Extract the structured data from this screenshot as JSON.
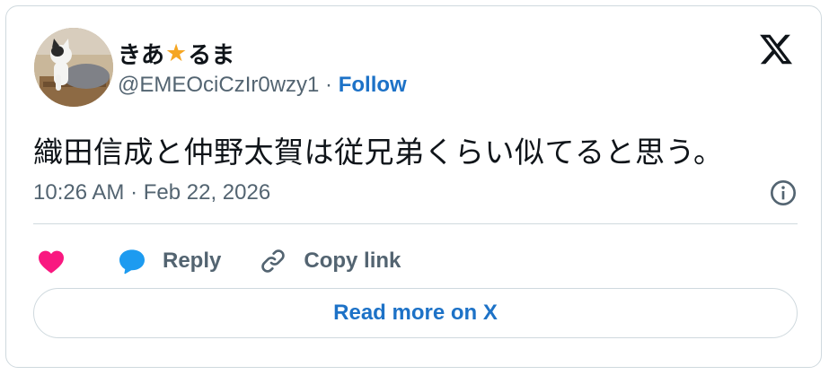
{
  "author": {
    "name_prefix": "きあ",
    "name_suffix": "るま",
    "handle": "@EMEOciCzIr0wzy1",
    "separator": " · ",
    "follow_label": "Follow"
  },
  "tweet": {
    "text": "織田信成と仲野太賀は従兄弟くらい似てると思う。",
    "timestamp": "10:26 AM · Feb 22, 2026"
  },
  "actions": {
    "reply_label": "Reply",
    "copy_link_label": "Copy link"
  },
  "read_more_label": "Read more on X",
  "colors": {
    "like": "#f91880",
    "reply_icon": "#1d9bf0",
    "link": "#1d72c7",
    "secondary_text": "#536471",
    "border": "#cfd9de"
  },
  "icons": [
    "x-logo-icon",
    "info-icon",
    "heart-icon",
    "reply-bubble-icon",
    "link-icon",
    "star-emoji-icon"
  ]
}
